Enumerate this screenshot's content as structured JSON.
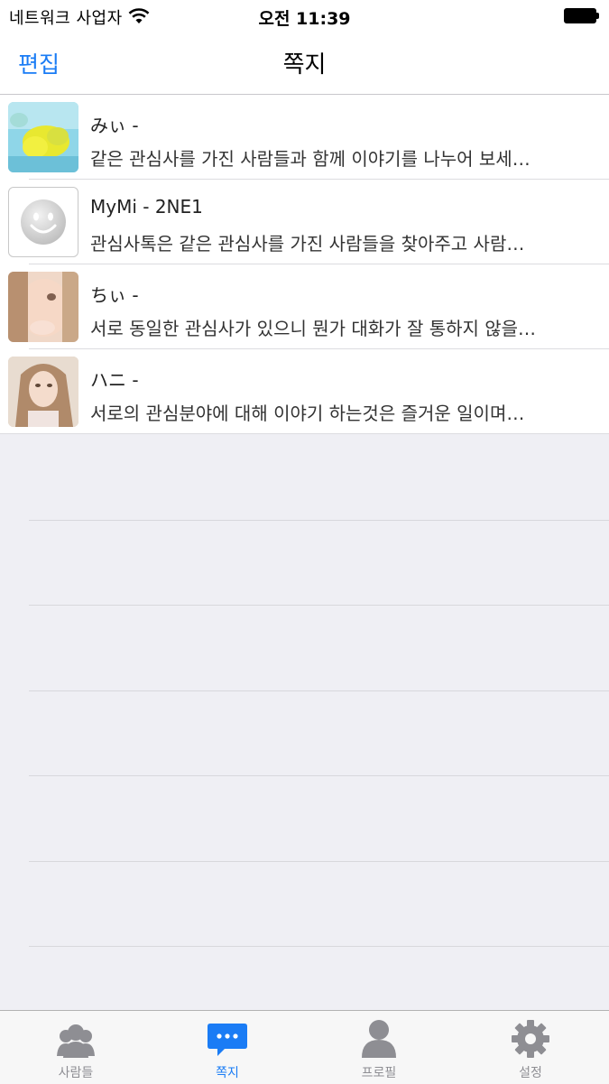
{
  "status_bar": {
    "carrier": "네트워크 사업자",
    "time": "오전 11:39"
  },
  "nav": {
    "edit_label": "편집",
    "title": "쪽지"
  },
  "messages": [
    {
      "name": "みぃ -",
      "preview": "같은 관심사를 가진 사람들과 함께 이야기를 나누어 보세…",
      "avatar": "photo-yellow-flower"
    },
    {
      "name": "MyMi - 2NE1",
      "preview": "관심사톡은 같은 관심사를 가진 사람들을 찾아주고 사람…",
      "avatar": "smiley-default"
    },
    {
      "name": "ちぃ -",
      "preview": "서로 동일한 관심사가 있으니 뭔가 대화가 잘 통하지 않을…",
      "avatar": "photo-portrait"
    },
    {
      "name": "ハニ -",
      "preview": "서로의 관심분야에 대해 이야기 하는것은 즐거운 일이며…",
      "avatar": "photo-portrait-hair"
    }
  ],
  "tabs": [
    {
      "label": "사람들",
      "icon": "people-icon",
      "active": false
    },
    {
      "label": "쪽지",
      "icon": "message-bubble-icon",
      "active": true
    },
    {
      "label": "프로필",
      "icon": "profile-icon",
      "active": false
    },
    {
      "label": "설정",
      "icon": "gear-icon",
      "active": false
    }
  ],
  "colors": {
    "accent": "#1a7cf5",
    "inactive_tab": "#8e8e93",
    "background": "#efeff4"
  }
}
